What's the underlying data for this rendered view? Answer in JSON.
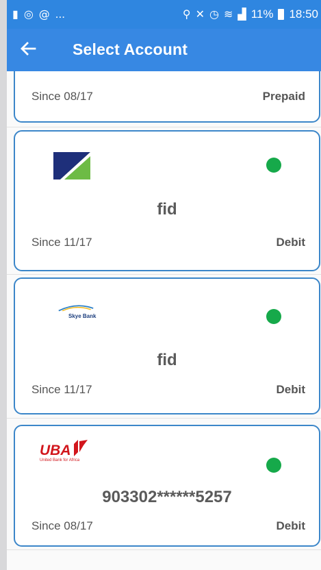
{
  "status_bar": {
    "left_icons": [
      "sim-icon",
      "alarm-icon",
      "mention-icon"
    ],
    "ellipsis": "...",
    "battery": "11%",
    "time": "18:50"
  },
  "app_bar": {
    "title": "Select Account"
  },
  "accounts": [
    {
      "logo": "",
      "number": "",
      "since": "Since 08/17",
      "type": "Prepaid",
      "active": false
    },
    {
      "logo": "fidelity-bank-logo",
      "number": "fid",
      "since": "Since 11/17",
      "type": "Debit",
      "active": true
    },
    {
      "logo": "skye-bank-logo",
      "logo_text": "Skye Bank",
      "number": "fid",
      "since": "Since 11/17",
      "type": "Debit",
      "active": true
    },
    {
      "logo": "uba-logo",
      "logo_text": "UBA",
      "logo_subtext": "United Bank for Africa",
      "number": "903302******5257",
      "since": "Since 08/17",
      "type": "Debit",
      "active": true
    }
  ],
  "colors": {
    "app_bar": "#3788e3",
    "card_border": "#3b86c9",
    "active_dot": "#16a94a",
    "uba_red": "#d2161c"
  }
}
